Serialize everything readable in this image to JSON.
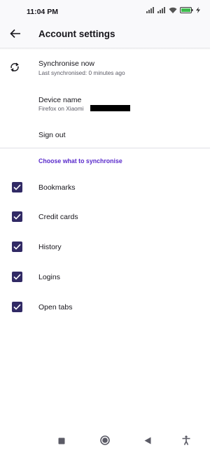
{
  "status_bar": {
    "time": "11:04 PM",
    "icons": [
      "signal-icon",
      "signal-icon",
      "wifi-icon",
      "battery-icon",
      "charging-icon"
    ]
  },
  "app_bar": {
    "title": "Account settings",
    "back_icon": "back-arrow-icon"
  },
  "account": {
    "sync_now_label": "Synchronise now",
    "sync_now_sub": "Last synchronised: 0 minutes ago",
    "device_name_label": "Device name",
    "device_name_value": "Firefox on Xiaomi",
    "sign_out_label": "Sign out"
  },
  "sync_section": {
    "header": "Choose what to synchronise",
    "items": [
      {
        "label": "Bookmarks",
        "checked": true
      },
      {
        "label": "Credit cards",
        "checked": true
      },
      {
        "label": "History",
        "checked": true
      },
      {
        "label": "Logins",
        "checked": true
      },
      {
        "label": "Open tabs",
        "checked": true
      }
    ]
  },
  "nav_bar": {
    "icons": [
      "recents-square-icon",
      "home-circle-icon",
      "back-triangle-icon",
      "accessibility-icon"
    ]
  },
  "colors": {
    "accent": "#592acb",
    "checkbox": "#312a65",
    "text": "#15141a",
    "secondary_text": "#5b5b66"
  }
}
